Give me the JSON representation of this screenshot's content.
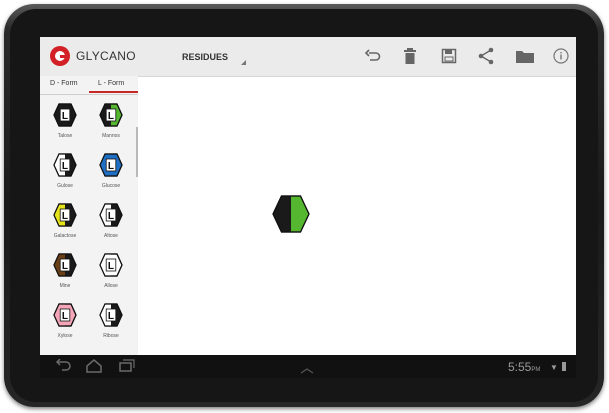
{
  "app": {
    "title": "GLYCANO"
  },
  "toolbar": {
    "dropdown_label": "RESIDUES",
    "icons": [
      "undo-icon",
      "delete-icon",
      "save-icon",
      "share-icon",
      "folder-icon",
      "info-icon"
    ]
  },
  "tabs": [
    {
      "label": "D - Form",
      "selected": false
    },
    {
      "label": "L - Form",
      "selected": true
    }
  ],
  "residues": [
    {
      "label": "Talose",
      "glyph": "L",
      "colors": [
        "#1a1a1a",
        "#1a1a1a"
      ]
    },
    {
      "label": "Mannos",
      "glyph": "L",
      "colors": [
        "#1a1a1a",
        "#55b72f"
      ]
    },
    {
      "label": "Gulose",
      "glyph": "L",
      "colors": [
        "#ffffff",
        "#1a1a1a"
      ]
    },
    {
      "label": "Glucose",
      "glyph": "L",
      "colors": [
        "#1f6fc4",
        "#1f6fc4"
      ]
    },
    {
      "label": "Galactose",
      "glyph": "L",
      "colors": [
        "#e6e31a",
        "#1a1a1a"
      ]
    },
    {
      "label": "Altose",
      "glyph": "L",
      "colors": [
        "#ffffff",
        "#1a1a1a"
      ]
    },
    {
      "label": "Mine",
      "glyph": "L",
      "colors": [
        "#6b3f15",
        "#1a1a1a"
      ]
    },
    {
      "label": "Allose",
      "glyph": "L",
      "colors": [
        "#ffffff",
        "#ffffff"
      ]
    },
    {
      "label": "Xylose",
      "glyph": "L",
      "colors": [
        "#f4a6b8",
        "#f4a6b8"
      ]
    },
    {
      "label": "Ribose",
      "glyph": "L",
      "colors": [
        "#ffffff",
        "#1a1a1a"
      ]
    }
  ],
  "canvas": {
    "residue_colors": [
      "#1a1a1a",
      "#55b72f"
    ]
  },
  "status": {
    "time": "5:55",
    "ampm": "PM"
  }
}
